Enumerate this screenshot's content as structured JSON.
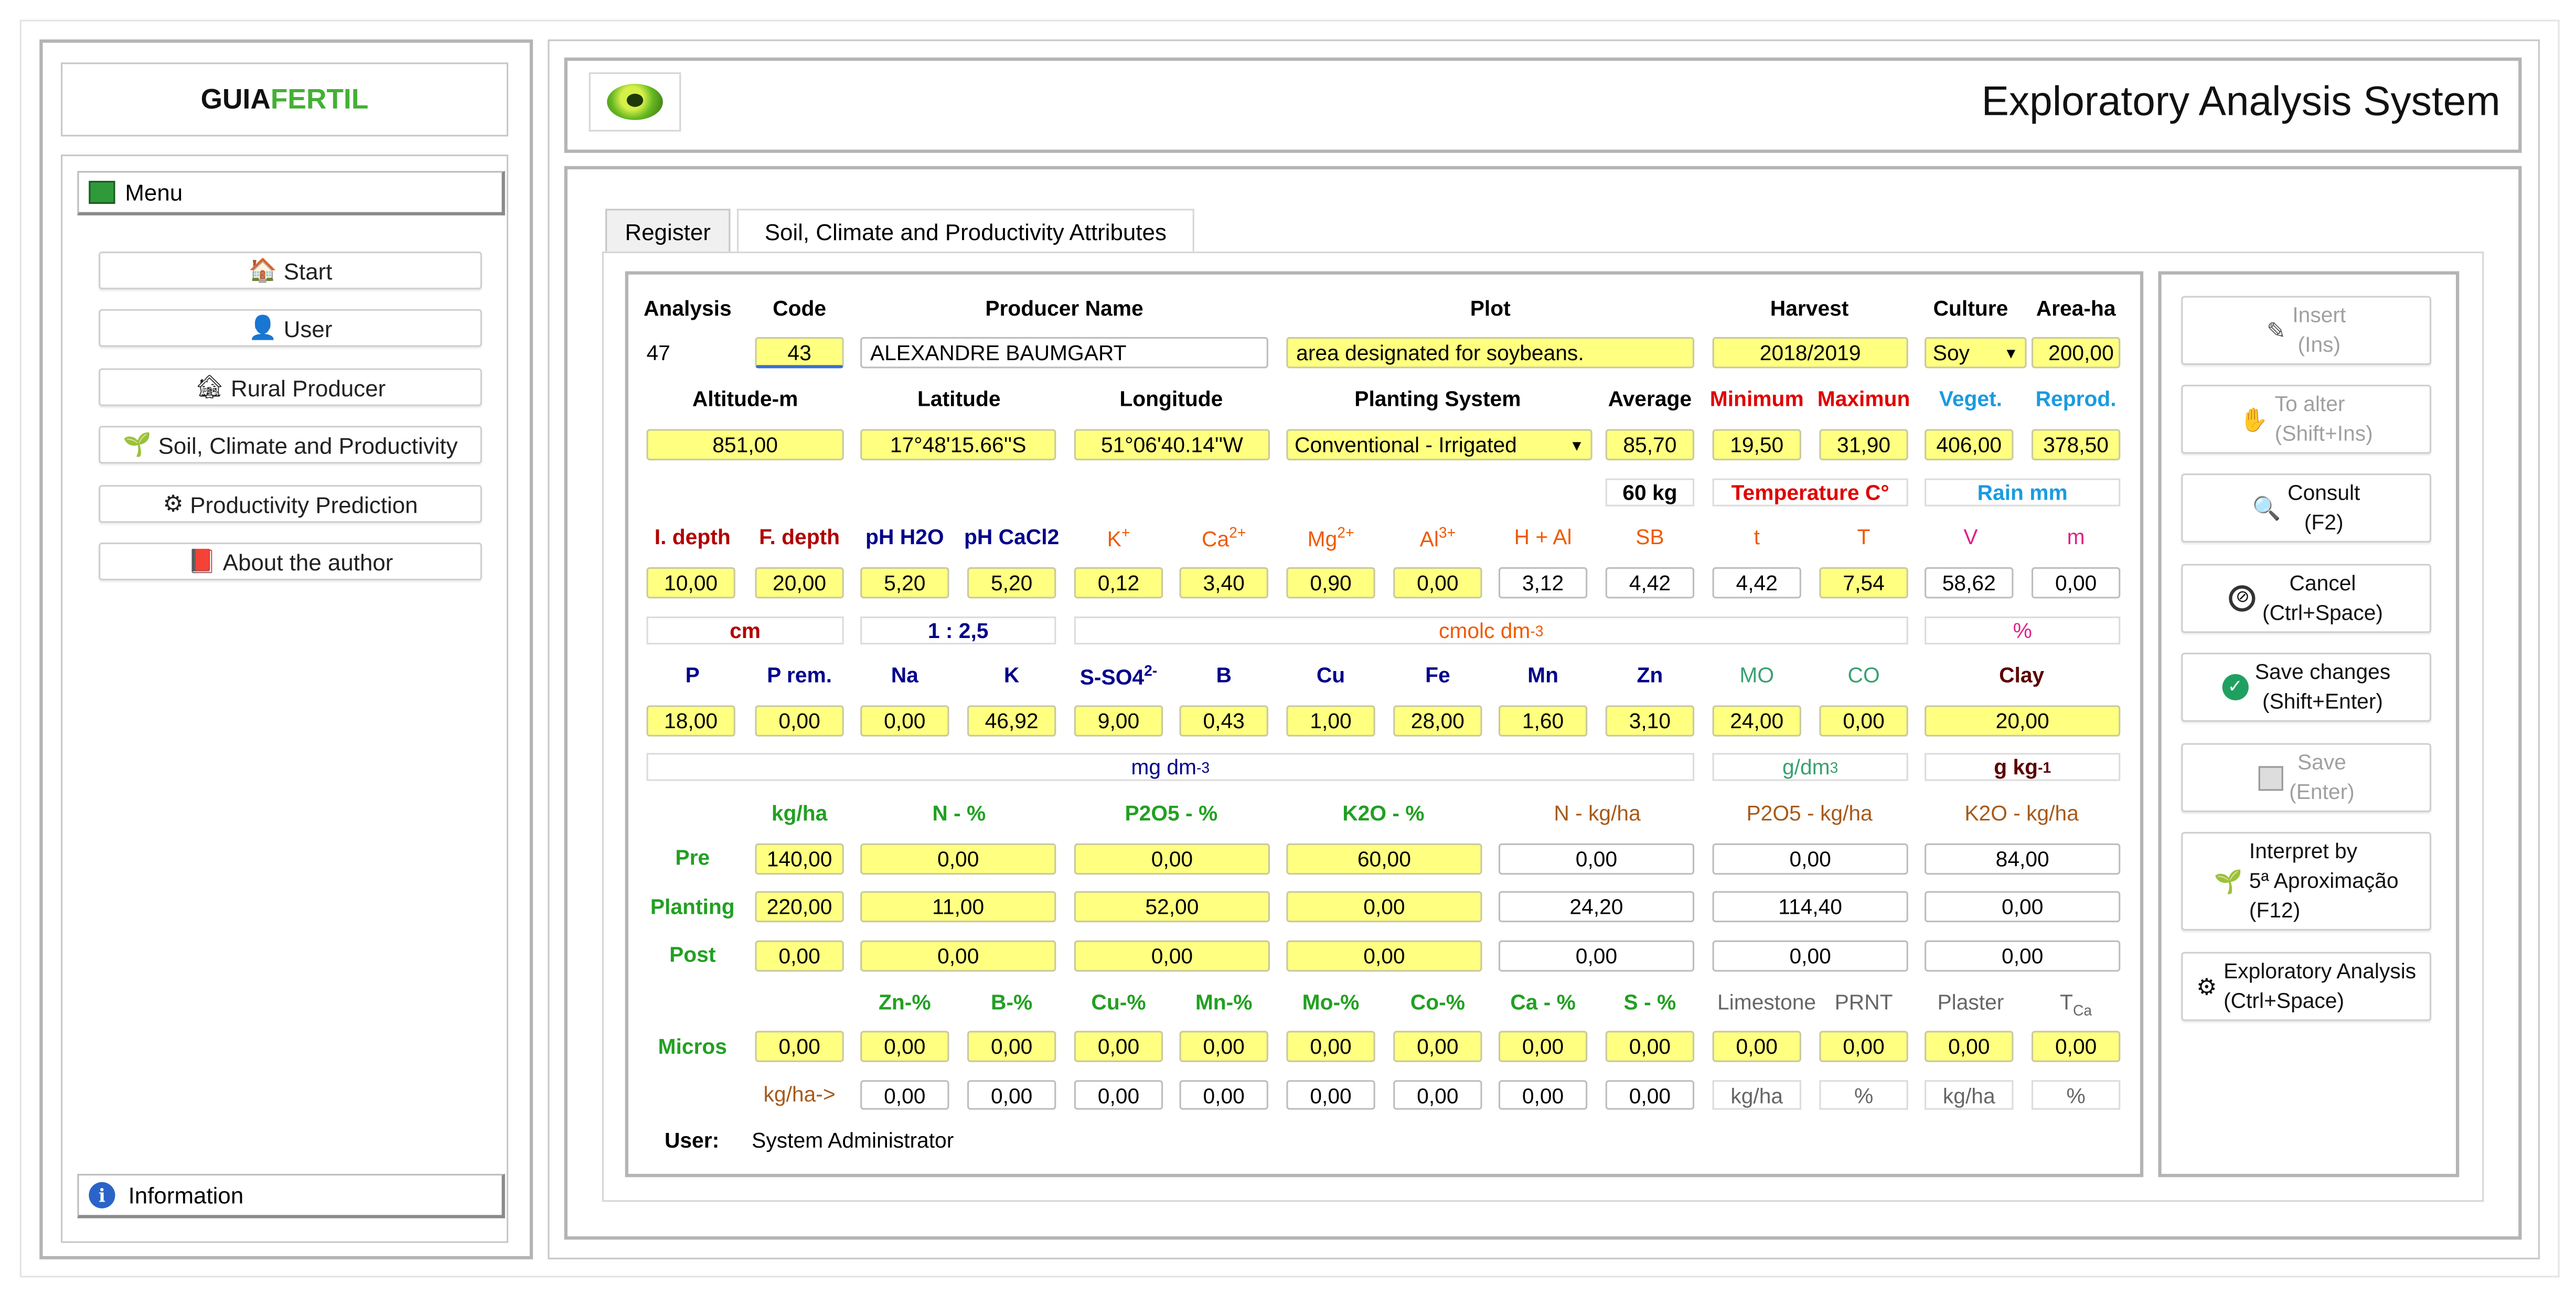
{
  "brand": {
    "part1": "GUIA",
    "part2": "FERTIL"
  },
  "header": {
    "title": "Exploratory Analysis System"
  },
  "sidebar": {
    "menu_label": "Menu",
    "items": [
      {
        "label": "Start",
        "icon": "house-icon"
      },
      {
        "label": "User",
        "icon": "user-icon"
      },
      {
        "label": "Rural Producer",
        "icon": "farmhouse-icon"
      },
      {
        "label": "Soil, Climate and Productivity",
        "icon": "seedling-icon"
      },
      {
        "label": "Productivity Prediction",
        "icon": "head-gear-icon"
      },
      {
        "label": "About the author",
        "icon": "book-icon"
      }
    ],
    "info_label": "Information"
  },
  "tabs": [
    {
      "label": "Register",
      "active": true
    },
    {
      "label": "Soil, Climate and Productivity Attributes",
      "active": false
    }
  ],
  "form": {
    "row1": {
      "analysis_label": "Analysis",
      "analysis_value": "47",
      "code_label": "Code",
      "code_value": "43",
      "producer_label": "Producer Name",
      "producer_value": "ALEXANDRE BAUMGART",
      "plot_label": "Plot",
      "plot_value": "area designated for soybeans.",
      "harvest_label": "Harvest",
      "harvest_value": "2018/2019",
      "culture_label": "Culture",
      "culture_value": "Soy",
      "area_label": "Area-ha",
      "area_value": "200,00"
    },
    "row2": {
      "altitude_label": "Altitude-m",
      "altitude_value": "851,00",
      "latitude_label": "Latitude",
      "latitude_value": "17°48'15.66''S",
      "longitude_label": "Longitude",
      "longitude_value": "51°06'40.14''W",
      "planting_label": "Planting System",
      "planting_value": "Conventional - Irrigated",
      "average_label": "Average",
      "average_value": "85,70",
      "average_unit": "60 kg",
      "minimum_label": "Minimum",
      "minimum_value": "19,50",
      "maximum_label": "Maximun",
      "maximum_value": "31,90",
      "temperature_unit": "Temperature C°",
      "veget_label": "Veget.",
      "veget_value": "406,00",
      "reprod_label": "Reprod.",
      "reprod_value": "378,50",
      "rain_unit": "Rain mm"
    },
    "row3": {
      "labels": [
        "I. depth",
        "F. depth",
        "pH H2O",
        "pH CaCl2",
        "K",
        "Ca",
        "Mg",
        "Al",
        "H + Al",
        "SB",
        "t",
        "T",
        "V",
        "m"
      ],
      "sups": {
        "K": "+",
        "Ca": "2+",
        "Mg": "2+",
        "Al": "3+"
      },
      "values": [
        "10,00",
        "20,00",
        "5,20",
        "5,20",
        "0,12",
        "3,40",
        "0,90",
        "0,00",
        "3,12",
        "4,42",
        "4,42",
        "7,54",
        "58,62",
        "0,00"
      ],
      "unit_cm": "cm",
      "unit_ratio": "1 : 2,5",
      "unit_cmolc": "cmolc dm",
      "unit_cmolc_sup": "-3",
      "unit_pct": "%"
    },
    "row4": {
      "labels": [
        "P",
        "P rem.",
        "Na",
        "K",
        "S-SO4",
        "B",
        "Cu",
        "Fe",
        "Mn",
        "Zn",
        "MO",
        "CO",
        "Clay"
      ],
      "sso4_sup": "2-",
      "values": [
        "18,00",
        "0,00",
        "0,00",
        "46,92",
        "9,00",
        "0,43",
        "1,00",
        "28,00",
        "1,60",
        "3,10",
        "24,00",
        "0,00",
        "20,00"
      ],
      "unit_mgdm": "mg dm",
      "unit_mgdm_sup": "-3",
      "unit_gdm": "g/dm",
      "unit_gdm_sup": "3",
      "unit_gkg": "g kg",
      "unit_gkg_sup": "-1"
    },
    "fert": {
      "headers": [
        "kg/ha",
        "N - %",
        "P2O5 - %",
        "K2O - %",
        "N - kg/ha",
        "P2O5 - kg/ha",
        "K2O - kg/ha"
      ],
      "rows": [
        {
          "label": "Pre",
          "values": [
            "140,00",
            "0,00",
            "0,00",
            "60,00",
            "0,00",
            "0,00",
            "84,00"
          ]
        },
        {
          "label": "Planting",
          "values": [
            "220,00",
            "11,00",
            "52,00",
            "0,00",
            "24,20",
            "114,40",
            "0,00"
          ]
        },
        {
          "label": "Post",
          "values": [
            "0,00",
            "0,00",
            "0,00",
            "0,00",
            "0,00",
            "0,00",
            "0,00"
          ]
        }
      ]
    },
    "micros": {
      "headers": [
        "Zn-%",
        "B-%",
        "Cu-%",
        "Mn-%",
        "Mo-%",
        "Co-%",
        "Ca - %",
        "S - %",
        "Limestone",
        "PRNT",
        "Plaster",
        "T"
      ],
      "tca_sub": "Ca",
      "label": "Micros",
      "values": [
        "0,00",
        "0,00",
        "0,00",
        "0,00",
        "0,00",
        "0,00",
        "0,00",
        "0,00",
        "0,00",
        "0,00",
        "0,00",
        "0,00",
        "0,00"
      ],
      "kg_label": "kg/ha->",
      "kg_values": [
        "0,00",
        "0,00",
        "0,00",
        "0,00",
        "0,00",
        "0,00",
        "0,00",
        "0,00"
      ],
      "unit_kgha1": "kg/ha",
      "unit_pct1": "%",
      "unit_kgha2": "kg/ha",
      "unit_pct2": "%"
    },
    "user_label": "User:",
    "user_value": "System Administrator"
  },
  "actions": [
    {
      "line1": "Insert",
      "line2": "(Ins)",
      "icon": "pencil-icon",
      "enabled": false
    },
    {
      "line1": "To alter",
      "line2": "(Shift+Ins)",
      "icon": "hand-edit-icon",
      "enabled": false
    },
    {
      "line1": "Consult",
      "line2": "(F2)",
      "icon": "magnifier-icon",
      "enabled": true
    },
    {
      "line1": "Cancel",
      "line2": "(Ctrl+Space)",
      "icon": "cancel-icon",
      "enabled": true
    },
    {
      "line1": "Save changes",
      "line2": "(Shift+Enter)",
      "icon": "check-icon",
      "enabled": true
    },
    {
      "line1": "Save",
      "line2": "(Enter)",
      "icon": "floppy-icon",
      "enabled": false
    },
    {
      "line1": "Interpret by",
      "line2": "5ª Aproximação",
      "line3": "(F12)",
      "icon": "sprout-icon",
      "enabled": true
    },
    {
      "line1": "Exploratory Analysis",
      "line2": "(Ctrl+Space)",
      "icon": "head-gear-icon",
      "enabled": true
    }
  ],
  "colors": {
    "field_yellow": "#ffff80",
    "brand_green": "#44b035",
    "label_darkred": "#b00000",
    "label_navy": "#00008b",
    "label_orange": "#f05a00",
    "label_red": "#e00000",
    "label_sky": "#1a9be0",
    "label_green": "#22a022",
    "label_teal": "#3aa070",
    "label_magenta": "#e0208a",
    "label_brown": "#a65a1a"
  }
}
